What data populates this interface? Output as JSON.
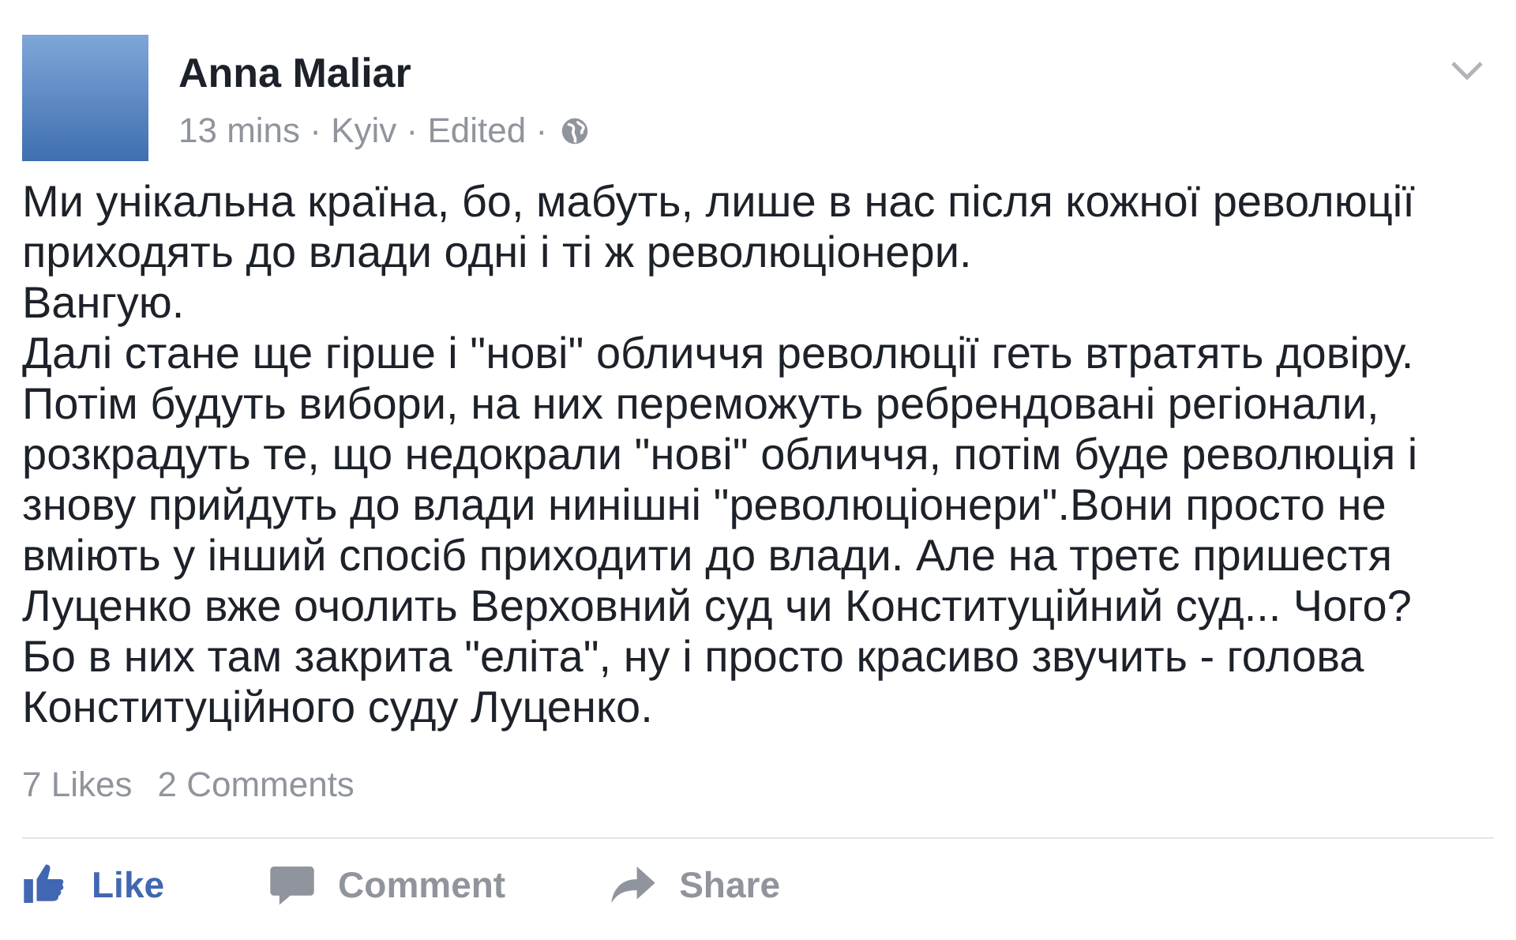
{
  "post": {
    "author": "Anna Maliar",
    "meta": "13 mins · Kyiv · Edited ·",
    "lines": [
      "Ми унікальна країна, бо, мабуть, лише в нас після кожної революції",
      "приходять до влади одні і ті ж революціонери.",
      "Вангую.",
      "Далі стане ще гірше і \"нові\" обличчя революції геть втратять довіру.",
      "Потім будуть вибори, на них переможуть ребрендовані регіонали,",
      "розкрадуть те, що недокрали \"нові\" обличчя, потім буде революція і",
      "знову прийдуть до влади нинішні \"революціонери\".Вони просто не",
      "вміють у інший спосіб приходити до влади. Але на третє пришестя",
      "Луценко вже очолить Верховний суд чи Конституційний суд... Чого?",
      "Бо в них там закрита \"еліта\", ну і просто красиво звучить - голова",
      "Конституційного суду Луценко."
    ],
    "stats": [
      "7 Likes",
      "2 Comments"
    ],
    "actions": [
      {
        "kind": "like",
        "label": "Like",
        "selected": true
      },
      {
        "kind": "comment",
        "label": "Comment",
        "selected": false
      },
      {
        "kind": "share",
        "label": "Share",
        "selected": false
      }
    ]
  }
}
